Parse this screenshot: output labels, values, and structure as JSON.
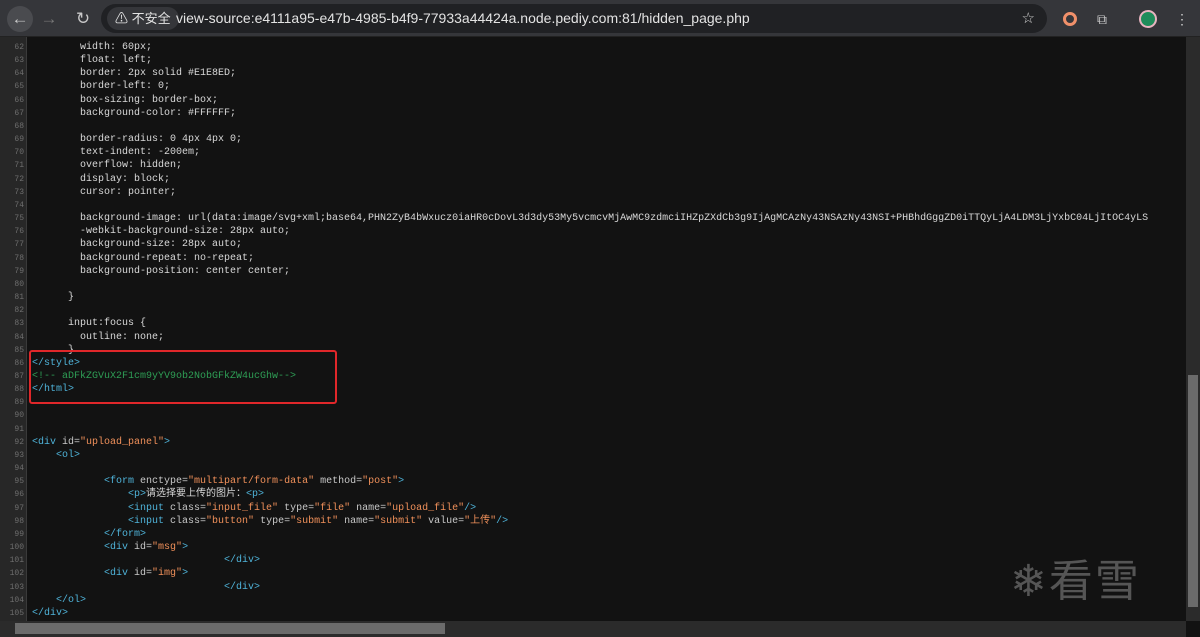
{
  "browser": {
    "security_chip": "⚠ 不安全",
    "url": "view-source:e4111a95-e47b-4985-b4f9-77933a44424a.node.pediy.com:81/hidden_page.php",
    "icons": [
      "back-icon",
      "forward-icon",
      "reload-icon",
      "star-icon",
      "extension-o-icon",
      "puzzle-icon",
      "avatar-icon",
      "kebab-menu-icon"
    ]
  },
  "source": {
    "first_line": 62,
    "lines": [
      [
        [
          "",
          "        width: 60px;"
        ]
      ],
      [
        [
          "",
          "        float: left;"
        ]
      ],
      [
        [
          "",
          "        border: 2px solid #E1E8ED;"
        ]
      ],
      [
        [
          "",
          "        border-left: 0;"
        ]
      ],
      [
        [
          "",
          "        box-sizing: border-box;"
        ]
      ],
      [
        [
          "",
          "        background-color: #FFFFFF;"
        ]
      ],
      [],
      [
        [
          "",
          "        border-radius: 0 4px 4px 0;"
        ]
      ],
      [
        [
          "",
          "        text-indent: -200em;"
        ]
      ],
      [
        [
          "",
          "        overflow: hidden;"
        ]
      ],
      [
        [
          "",
          "        display: block;"
        ]
      ],
      [
        [
          "",
          "        cursor: pointer;"
        ]
      ],
      [],
      [
        [
          "",
          "        background-image: url(data:image/svg+xml;base64,PHN2ZyB4bWxucz0iaHR0cDovL3d3dy53My5vcmcvMjAwMC9zdmciIHZpZXdCb3g9IjAgMCAzNy43NSAzNy43NSI+PHBhdGggZD0iTTQyLjA4LDM3LjYxbC04LjItOC4yLS"
        ]
      ],
      [
        [
          "",
          "        -webkit-background-size: 28px auto;"
        ]
      ],
      [
        [
          "",
          "        background-size: 28px auto;"
        ]
      ],
      [
        [
          "",
          "        background-repeat: no-repeat;"
        ]
      ],
      [
        [
          "",
          "        background-position: center center;"
        ]
      ],
      [],
      [
        [
          "",
          "      }"
        ]
      ],
      [],
      [
        [
          "",
          "      input:focus {"
        ]
      ],
      [
        [
          "",
          "        outline: none;"
        ]
      ],
      [
        [
          "",
          "      }"
        ]
      ],
      [
        [
          "t",
          "</style>"
        ]
      ],
      [
        [
          "c",
          "<!-- aDFkZGVuX2F1cm9yYV9ob2NobGFkZW4ucGhw-->"
        ]
      ],
      [
        [
          "t",
          "</html>"
        ]
      ],
      [],
      [],
      [],
      [
        [
          "t",
          "<div "
        ],
        [
          "a",
          "id="
        ],
        [
          "v",
          "\"upload_panel\""
        ],
        [
          "t",
          ">"
        ]
      ],
      [
        [
          "t",
          "    <ol>"
        ]
      ],
      [],
      [
        [
          "t",
          "            <form "
        ],
        [
          "a",
          "enctype="
        ],
        [
          "v",
          "\"multipart/form-data\""
        ],
        [
          "a",
          " method="
        ],
        [
          "v",
          "\"post\""
        ],
        [
          "t",
          ">"
        ]
      ],
      [
        [
          "t",
          "                <p>"
        ],
        [
          "",
          "请选择要上传的图片："
        ],
        [
          "t",
          "<p>"
        ]
      ],
      [
        [
          "t",
          "                <input "
        ],
        [
          "a",
          "class="
        ],
        [
          "v",
          "\"input_file\""
        ],
        [
          "a",
          " type="
        ],
        [
          "v",
          "\"file\""
        ],
        [
          "a",
          " name="
        ],
        [
          "v",
          "\"upload_file\""
        ],
        [
          "t",
          "/>"
        ]
      ],
      [
        [
          "t",
          "                <input "
        ],
        [
          "a",
          "class="
        ],
        [
          "v",
          "\"button\""
        ],
        [
          "a",
          " type="
        ],
        [
          "v",
          "\"submit\""
        ],
        [
          "a",
          " name="
        ],
        [
          "v",
          "\"submit\""
        ],
        [
          "a",
          " value="
        ],
        [
          "v",
          "\"上传\""
        ],
        [
          "t",
          "/>"
        ]
      ],
      [
        [
          "t",
          "            </form>"
        ]
      ],
      [
        [
          "t",
          "            <div "
        ],
        [
          "a",
          "id="
        ],
        [
          "v",
          "\"msg\""
        ],
        [
          "t",
          ">"
        ]
      ],
      [
        [
          "t",
          "                                </div>"
        ]
      ],
      [
        [
          "t",
          "            <div "
        ],
        [
          "a",
          "id="
        ],
        [
          "v",
          "\"img\""
        ],
        [
          "t",
          ">"
        ]
      ],
      [
        [
          "t",
          "                                </div>"
        ]
      ],
      [
        [
          "t",
          "    </ol>"
        ]
      ],
      [
        [
          "t",
          "</div>"
        ]
      ]
    ]
  },
  "watermark": "看雪",
  "colors": {
    "tag": "#4fb3d9",
    "attr_value": "#f0905a",
    "comment": "#2e9e55",
    "highlight_box": "#e0272a"
  }
}
